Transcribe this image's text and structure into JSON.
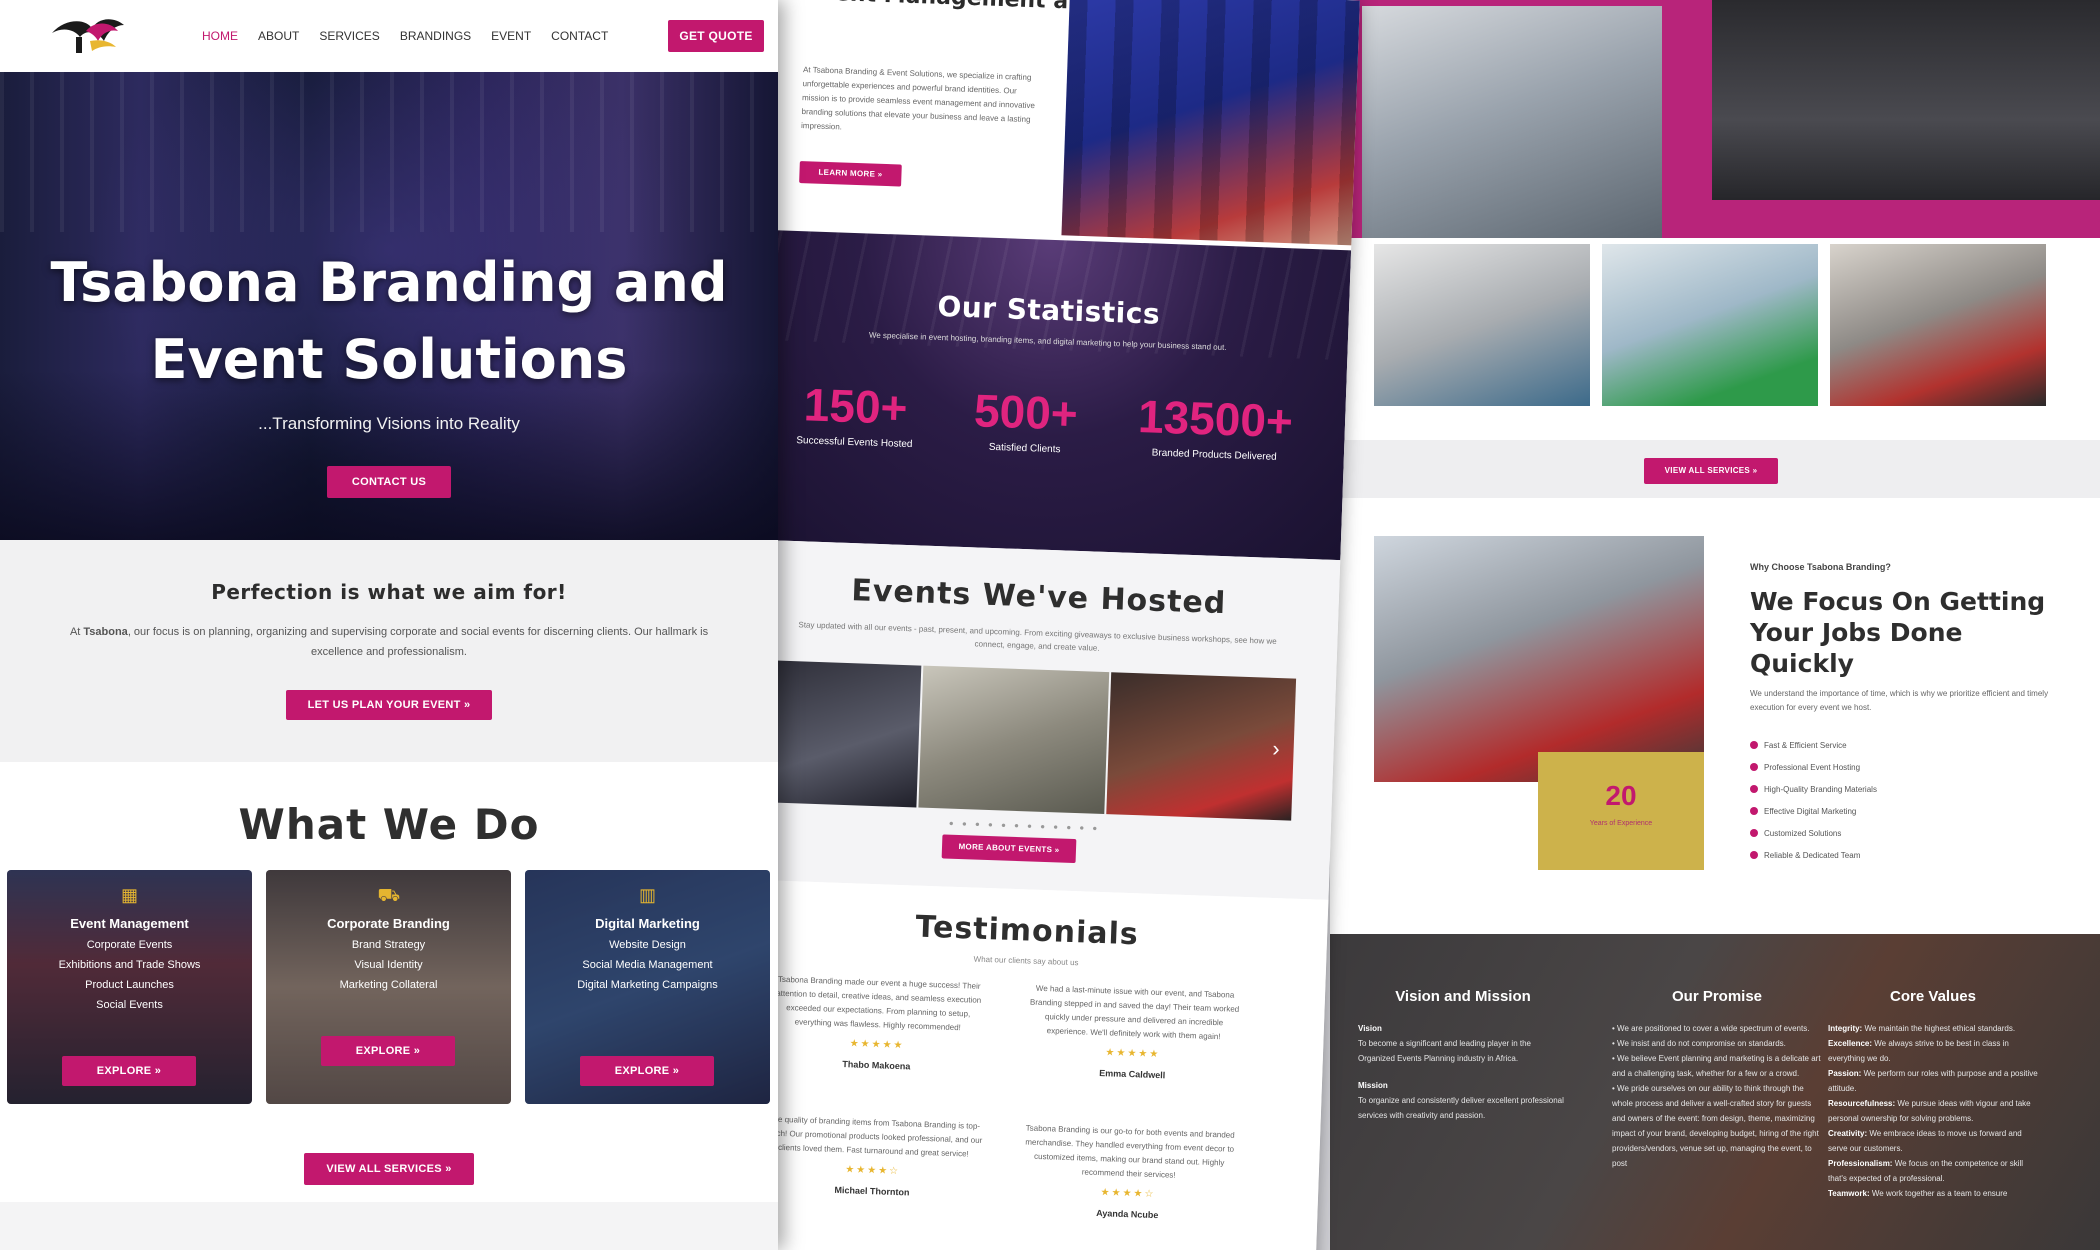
{
  "nav": {
    "items": [
      "HOME",
      "ABOUT",
      "SERVICES",
      "BRANDINGS",
      "EVENT",
      "CONTACT"
    ],
    "cta": "GET QUOTE"
  },
  "hero": {
    "title": "Tsabona Branding and Event Solutions",
    "subtitle": "...Transforming Visions into Reality",
    "button": "CONTACT US"
  },
  "perfection": {
    "heading": "Perfection is what we aim for!",
    "body_prefix": "At ",
    "body_brand": "Tsabona",
    "body_rest": ", our focus is on planning, organizing and supervising corporate and social events for discerning clients. Our hallmark is excellence and professionalism.",
    "button": "LET US PLAN YOUR EVENT »"
  },
  "what_we_do": {
    "heading": "What We Do",
    "button": "VIEW ALL SERVICES »",
    "cards": [
      {
        "title": "Event Management",
        "icon": "calendar-icon",
        "items": [
          "Corporate Events",
          "Exhibitions and Trade Shows",
          "Product Launches",
          "Social Events"
        ],
        "button": "EXPLORE »"
      },
      {
        "title": "Corporate Branding",
        "icon": "truck-icon",
        "items": [
          "Brand Strategy",
          "Visual Identity",
          "Marketing Collateral"
        ],
        "button": "EXPLORE »"
      },
      {
        "title": "Digital Marketing",
        "icon": "bar-chart-icon",
        "items": [
          "Website Design",
          "Social Media Management",
          "Digital Marketing Campaigns"
        ],
        "button": "EXPLORE »"
      }
    ]
  },
  "event_corp": {
    "heading": "Event Management and Corporate Branding",
    "body": "At Tsabona Branding & Event Solutions, we specialize in crafting unforgettable experiences and powerful brand identities. Our mission is to provide seamless event management and innovative branding solutions that elevate your business and leave a lasting impression.",
    "button": "LEARN MORE »"
  },
  "statistics": {
    "heading": "Our Statistics",
    "subtitle": "We specialise in event hosting, branding items, and digital marketing to help your business stand out.",
    "items": [
      {
        "value": "150+",
        "label": "Successful Events Hosted"
      },
      {
        "value": "500+",
        "label": "Satisfied Clients"
      },
      {
        "value": "13500+",
        "label": "Branded Products Delivered"
      }
    ]
  },
  "events": {
    "heading": "Events We've Hosted",
    "subtitle": "Stay updated with all our events - past, present, and upcoming. From exciting giveaways to exclusive business workshops, see how we connect, engage, and create value.",
    "button": "MORE ABOUT EVENTS »"
  },
  "testimonials": {
    "heading": "Testimonials",
    "subtitle": "What our clients say about us",
    "items": [
      {
        "quote": "Tsabona Branding made our event a huge success! Their attention to detail, creative ideas, and seamless execution exceeded our expectations. From planning to setup, everything was flawless. Highly recommended!",
        "name": "Thabo Makoena",
        "stars": "★★★★★"
      },
      {
        "quote": "We had a last-minute issue with our event, and Tsabona Branding stepped in and saved the day! Their team worked quickly under pressure and delivered an incredible experience. We'll definitely work with them again!",
        "name": "Emma Caldwell",
        "stars": "★★★★★"
      },
      {
        "quote": "The quality of branding items from Tsabona Branding is top-notch! Our promotional products looked professional, and our clients loved them. Fast turnaround and great service!",
        "name": "Michael Thornton",
        "stars": "★★★★☆"
      },
      {
        "quote": "Tsabona Branding is our go-to for both events and branded merchandise. They handled everything from event decor to customized items, making our brand stand out. Highly recommend their services!",
        "name": "Ayanda Ncube",
        "stars": "★★★★☆"
      }
    ]
  },
  "services_panel": {
    "button": "VIEW ALL SERVICES »"
  },
  "why": {
    "kicker": "Why Choose Tsabona Branding?",
    "heading": "We Focus On Getting Your Jobs Done Quickly",
    "body": "We understand the importance of time, which is why we prioritize efficient and timely execution for every event we host.",
    "years": "20",
    "years_label": "Years of Experience",
    "list": [
      "Fast & Efficient Service",
      "Professional Event Hosting",
      "High-Quality Branding Materials",
      "Effective Digital Marketing",
      "Customized Solutions",
      "Reliable & Dedicated Team"
    ]
  },
  "vmv": {
    "vision": {
      "heading": "Vision and Mission",
      "vision_label": "Vision",
      "vision_text": "To become a significant and leading player in the Organized Events Planning industry in Africa.",
      "mission_label": "Mission",
      "mission_text": "To organize and consistently deliver excellent professional services with creativity and passion."
    },
    "promise": {
      "heading": "Our Promise",
      "items": [
        "We are positioned to cover a wide spectrum of events.",
        "We insist and do not compromise on standards.",
        "We believe Event planning and marketing is a delicate art and a challenging task, whether for a few or a crowd.",
        "We pride ourselves on our ability to think through the whole process and deliver a well-crafted story for guests and owners of the event: from design, theme, maximizing impact of your brand, developing budget, hiring of the right providers/vendors, venue set up, managing the event, to post"
      ]
    },
    "values": {
      "heading": "Core Values",
      "items": [
        {
          "k": "Integrity:",
          "v": " We maintain the highest ethical standards."
        },
        {
          "k": "Excellence:",
          "v": " We always strive to be best in class in everything we do."
        },
        {
          "k": "Passion:",
          "v": " We perform our roles with purpose and a positive attitude."
        },
        {
          "k": "Resourcefulness:",
          "v": " We pursue ideas with vigour and take personal ownership for solving problems."
        },
        {
          "k": "Creativity:",
          "v": " We embrace ideas to move us forward and serve our customers."
        },
        {
          "k": "Professionalism:",
          "v": " We focus on the competence or skill that's expected of a professional."
        },
        {
          "k": "Teamwork:",
          "v": " We work together as a team to ensure"
        }
      ]
    }
  },
  "colors": {
    "accent": "#c2186e",
    "gold": "#cdb24b"
  }
}
